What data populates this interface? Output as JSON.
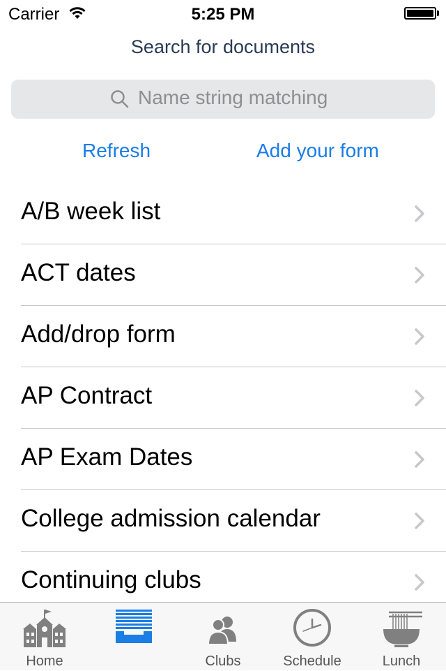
{
  "status": {
    "carrier": "Carrier",
    "time": "5:25 PM",
    "battery_level": 1.0
  },
  "header": {
    "title": "Search for documents"
  },
  "search": {
    "placeholder": "Name string matching",
    "icon": "search-icon"
  },
  "actions": {
    "refresh_label": "Refresh",
    "add_form_label": "Add your form"
  },
  "documents": [
    {
      "label": "A/B week list"
    },
    {
      "label": "ACT dates"
    },
    {
      "label": "Add/drop form"
    },
    {
      "label": "AP Contract"
    },
    {
      "label": "AP Exam Dates"
    },
    {
      "label": "College admission calendar"
    },
    {
      "label": "Continuing clubs"
    }
  ],
  "tabs": [
    {
      "label": "Home",
      "icon": "school-building-icon",
      "selected": false
    },
    {
      "label": "",
      "icon": "document-tray-icon",
      "selected": true
    },
    {
      "label": "Clubs",
      "icon": "people-icon",
      "selected": false
    },
    {
      "label": "Schedule",
      "icon": "clock-icon",
      "selected": false
    },
    {
      "label": "Lunch",
      "icon": "noodle-bowl-icon",
      "selected": false
    }
  ],
  "colors": {
    "accent": "#1b7de6",
    "title": "#2a3b55",
    "search_bg": "#e6e7e9",
    "tab_inactive": "#808080",
    "separator": "#c8c7cc"
  }
}
